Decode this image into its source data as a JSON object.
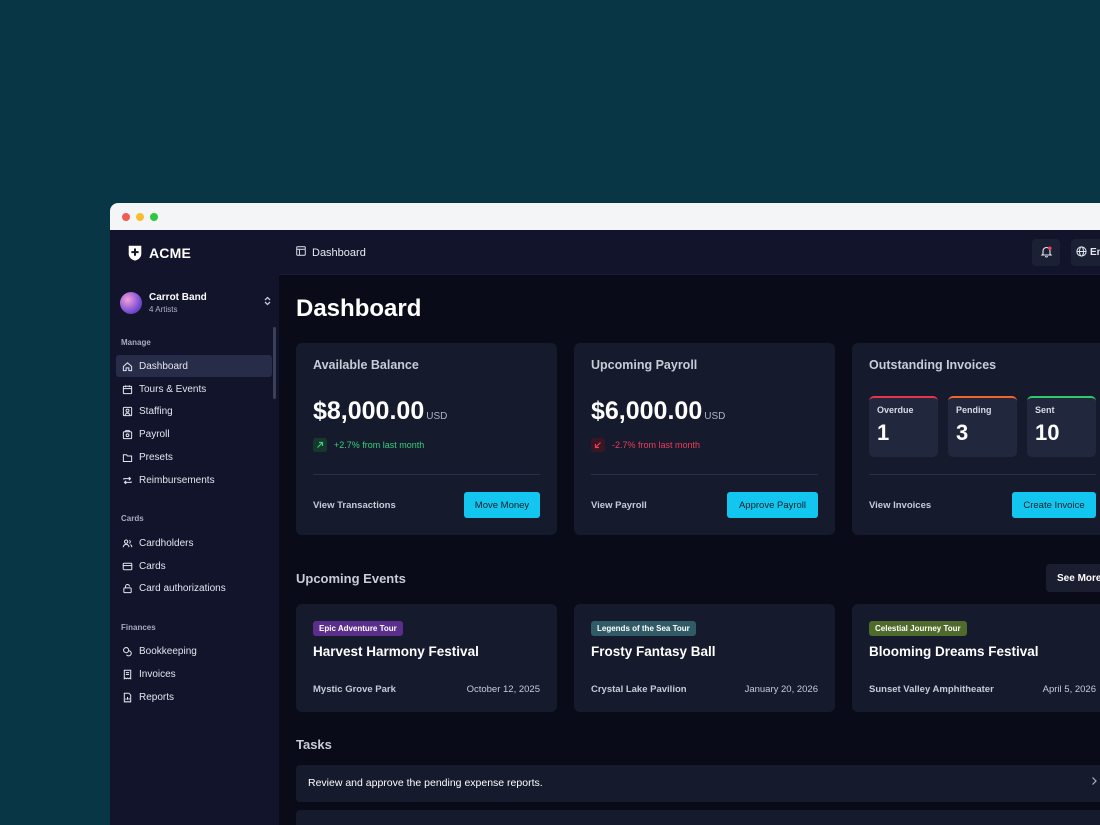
{
  "brand": {
    "name": "ACME"
  },
  "org": {
    "name": "Carrot Band",
    "subtitle": "4 Artists"
  },
  "sidebar": {
    "sections": [
      {
        "title": "Manage",
        "items": [
          {
            "label": "Dashboard",
            "icon": "home-icon",
            "active": true
          },
          {
            "label": "Tours & Events",
            "icon": "calendar-icon"
          },
          {
            "label": "Staffing",
            "icon": "user-square-icon"
          },
          {
            "label": "Payroll",
            "icon": "payroll-icon"
          },
          {
            "label": "Presets",
            "icon": "folder-icon"
          },
          {
            "label": "Reimbursements",
            "icon": "repeat-icon"
          }
        ]
      },
      {
        "title": "Cards",
        "items": [
          {
            "label": "Cardholders",
            "icon": "users-icon"
          },
          {
            "label": "Cards",
            "icon": "credit-card-icon"
          },
          {
            "label": "Card authorizations",
            "icon": "lock-icon"
          }
        ]
      },
      {
        "title": "Finances",
        "items": [
          {
            "label": "Bookkeeping",
            "icon": "coins-icon"
          },
          {
            "label": "Invoices",
            "icon": "invoice-icon"
          },
          {
            "label": "Reports",
            "icon": "report-icon"
          }
        ]
      }
    ]
  },
  "topbar": {
    "breadcrumb": "Dashboard",
    "language": "En"
  },
  "page": {
    "title": "Dashboard"
  },
  "cards": {
    "balance": {
      "title": "Available Balance",
      "amount": "$8,000.00",
      "currency": "USD",
      "trend": "+2.7% from last month",
      "link": "View Transactions",
      "button": "Move Money"
    },
    "payroll": {
      "title": "Upcoming Payroll",
      "amount": "$6,000.00",
      "currency": "USD",
      "trend": "-2.7% from last month",
      "link": "View Payroll",
      "button": "Approve Payroll"
    },
    "invoices": {
      "title": "Outstanding Invoices",
      "stats": [
        {
          "label": "Overdue",
          "value": "1",
          "color": "#e5354d"
        },
        {
          "label": "Pending",
          "value": "3",
          "color": "#f0652c"
        },
        {
          "label": "Sent",
          "value": "10",
          "color": "#2fc86a"
        }
      ],
      "link": "View Invoices",
      "button": "Create Invoice"
    }
  },
  "events": {
    "title": "Upcoming Events",
    "see_more": "See More",
    "items": [
      {
        "tag": "Epic Adventure Tour",
        "tag_color": "#5b2e8c",
        "name": "Harvest Harmony Festival",
        "venue": "Mystic Grove Park",
        "date": "October 12, 2025"
      },
      {
        "tag": "Legends of the Sea Tour",
        "tag_color": "#2f5a66",
        "name": "Frosty Fantasy Ball",
        "venue": "Crystal Lake Pavilion",
        "date": "January 20, 2026"
      },
      {
        "tag": "Celestial Journey Tour",
        "tag_color": "#4f6a2a",
        "name": "Blooming Dreams Festival",
        "venue": "Sunset Valley Amphitheater",
        "date": "April 5, 2026"
      }
    ]
  },
  "tasks": {
    "title": "Tasks",
    "items": [
      {
        "text": "Review and approve the pending expense reports."
      }
    ]
  }
}
